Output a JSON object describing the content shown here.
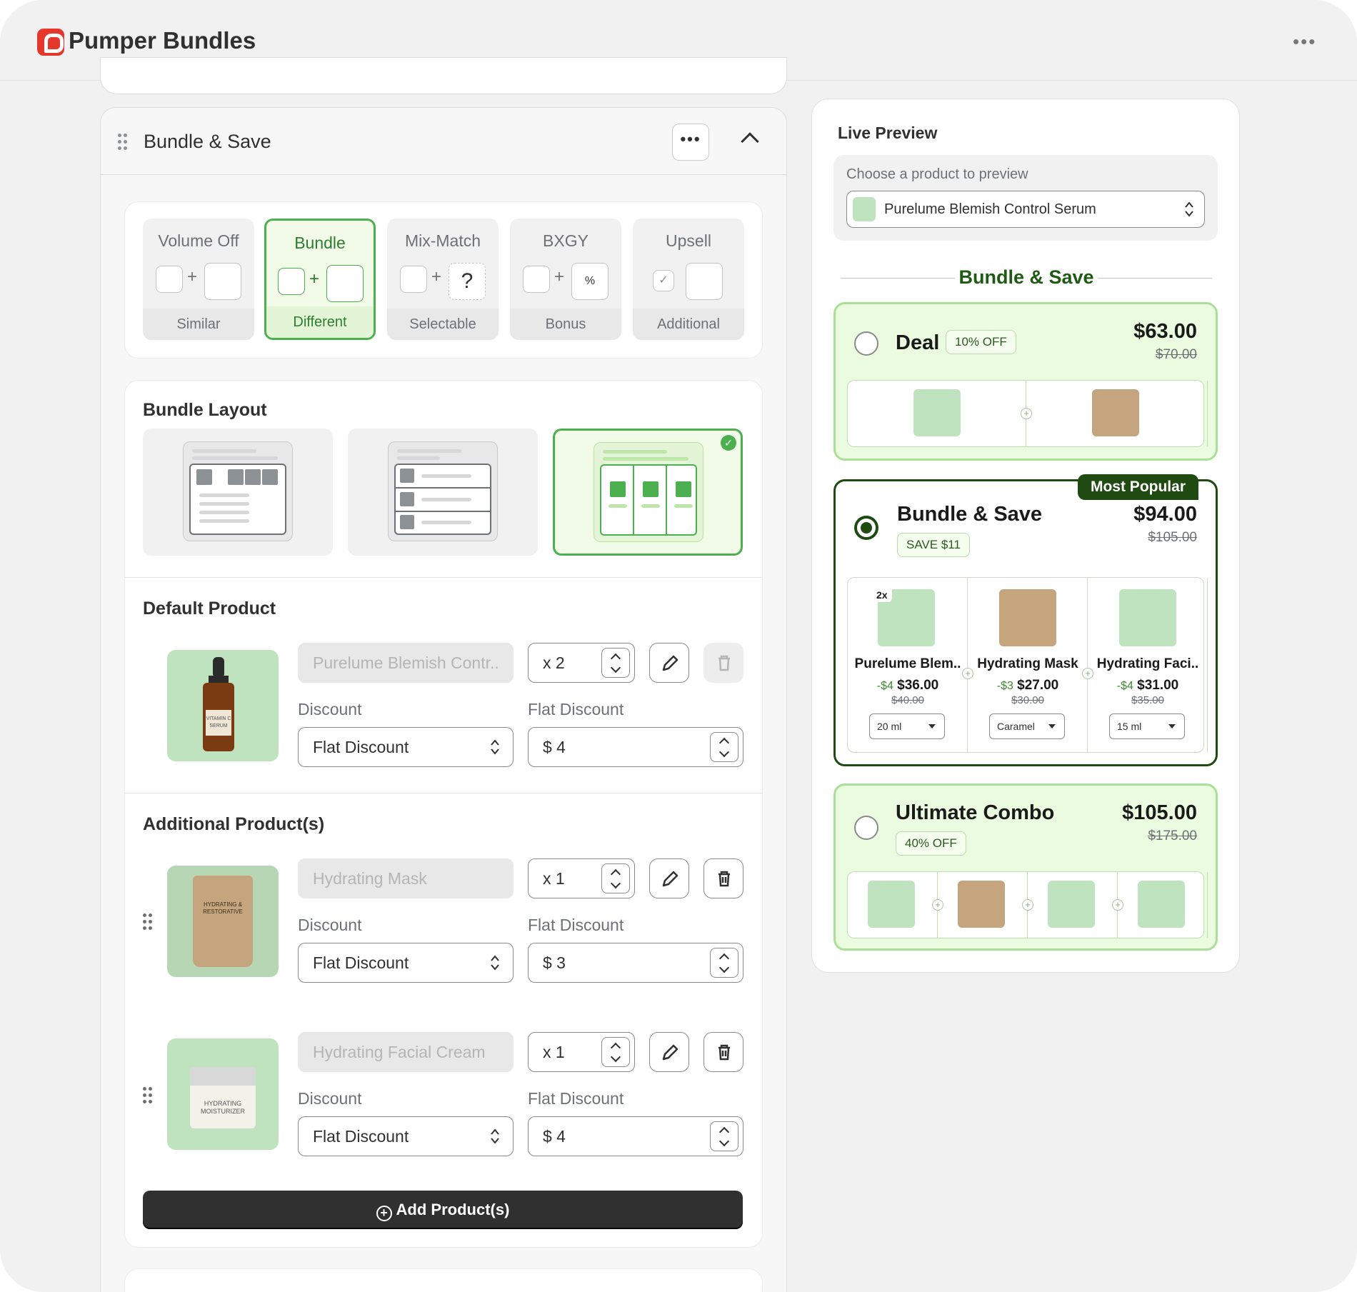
{
  "app": {
    "title": "Pumper Bundles"
  },
  "card": {
    "title": "Bundle & Save"
  },
  "types": [
    {
      "label": "Volume Off",
      "sub": "Similar"
    },
    {
      "label": "Bundle",
      "sub": "Different"
    },
    {
      "label": "Mix-Match",
      "sub": "Selectable"
    },
    {
      "label": "BXGY",
      "sub": "Bonus"
    },
    {
      "label": "Upsell",
      "sub": "Additional"
    }
  ],
  "layout": {
    "title": "Bundle Layout",
    "selected_index": 2
  },
  "default_product": {
    "title": "Default Product",
    "name": "Purelume Blemish Contr..",
    "qty": "x 2",
    "discount_label": "Discount",
    "discount_type": "Flat Discount",
    "flat_label": "Flat Discount",
    "flat_value": "$ 4",
    "img_text": "VITAMIN C SERUM"
  },
  "additional": {
    "title": "Additional Product(s)",
    "items": [
      {
        "name": "Hydrating Mask",
        "qty": "x 1",
        "discount_label": "Discount",
        "discount_type": "Flat Discount",
        "flat_label": "Flat Discount",
        "flat_value": "$ 3",
        "img_text": "HYDRATING & RESTORATIVE"
      },
      {
        "name": "Hydrating Facial Cream",
        "qty": "x 1",
        "discount_label": "Discount",
        "discount_type": "Flat Discount",
        "flat_label": "Flat Discount",
        "flat_value": "$ 4",
        "img_text": "HYDRATING MOISTURIZER"
      }
    ],
    "add_button": "Add Product(s)"
  },
  "preview": {
    "title": "Live Preview",
    "choose_label": "Choose a product to preview",
    "selected_product": "Purelume Blemish Control Serum",
    "section_title": "Bundle & Save",
    "offers": [
      {
        "name": "Deal",
        "badge": "10% OFF",
        "price": "$63.00",
        "old": "$70.00"
      },
      {
        "name": "Bundle & Save",
        "badge": "SAVE $11",
        "price": "$94.00",
        "old": "$105.00",
        "popular": "Most Popular",
        "products": [
          {
            "qty": "2x",
            "name": "Purelume Blem..",
            "disc": "-$4",
            "price": "$36.00",
            "old": "$40.00",
            "variant": "20 ml"
          },
          {
            "name": "Hydrating Mask",
            "disc": "-$3",
            "price": "$27.00",
            "old": "$30.00",
            "variant": "Caramel"
          },
          {
            "name": "Hydrating Faci..",
            "disc": "-$4",
            "price": "$31.00",
            "old": "$35.00",
            "variant": "15 ml"
          }
        ]
      },
      {
        "name": "Ultimate Combo",
        "badge": "40% OFF",
        "price": "$105.00",
        "old": "$175.00"
      }
    ]
  },
  "colors": {
    "accent": "#4caf50",
    "dark_green": "#1f4a12",
    "brand_red": "#e5372c",
    "light_green": "#eafbe0"
  }
}
